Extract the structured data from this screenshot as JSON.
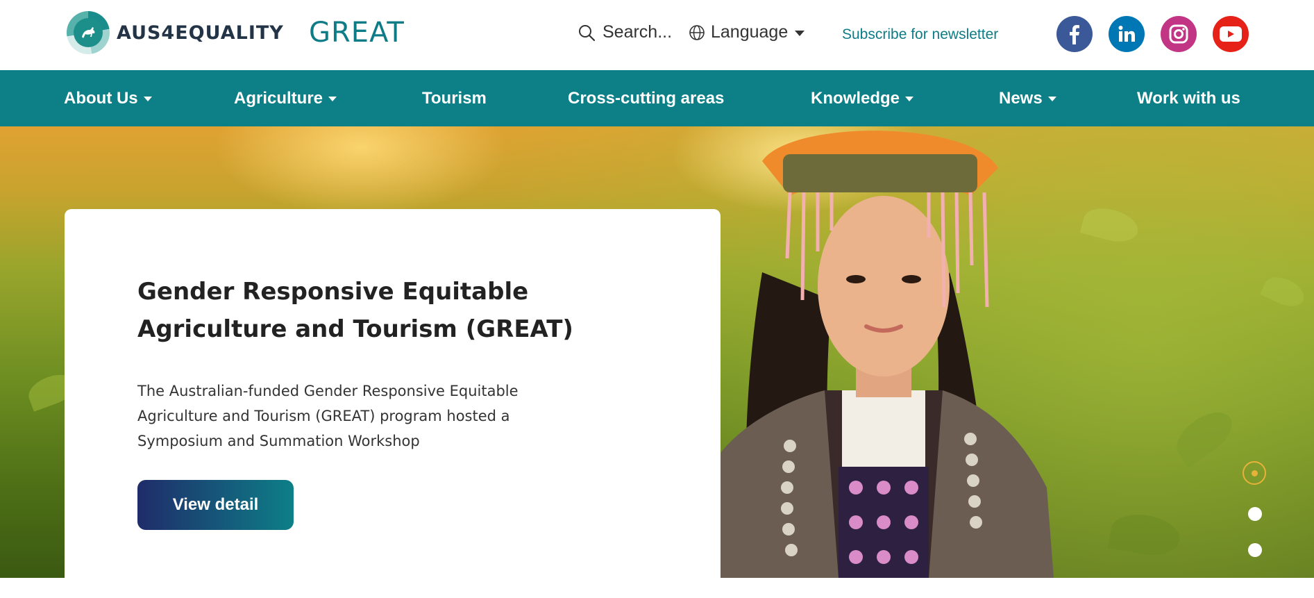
{
  "header": {
    "logo_text": "AUS4EQUALITY",
    "logo_great_text": "GREAT",
    "search_placeholder": "Search...",
    "language_label": "Language",
    "newsletter_label": "Subscribe for newsletter",
    "social": [
      {
        "name": "facebook",
        "icon": "facebook-icon",
        "color": "#3b5998"
      },
      {
        "name": "linkedin",
        "icon": "linkedin-icon",
        "color": "#0077b5"
      },
      {
        "name": "instagram",
        "icon": "instagram-icon",
        "color": "#c13584"
      },
      {
        "name": "youtube",
        "icon": "youtube-icon",
        "color": "#e62117"
      }
    ]
  },
  "nav": {
    "items": [
      {
        "label": "About Us",
        "has_dropdown": true
      },
      {
        "label": "Agriculture",
        "has_dropdown": true
      },
      {
        "label": "Tourism",
        "has_dropdown": false
      },
      {
        "label": "Cross-cutting areas",
        "has_dropdown": false
      },
      {
        "label": "Knowledge",
        "has_dropdown": true
      },
      {
        "label": "News",
        "has_dropdown": true
      },
      {
        "label": "Work with us",
        "has_dropdown": false
      }
    ],
    "background": "#0d7f87"
  },
  "hero": {
    "title": "Gender Responsive Equitable Agriculture and Tourism (GREAT)",
    "description": "The Australian-funded Gender Responsive Equitable Agriculture and Tourism (GREAT) program hosted a Symposium and Summation Workshop",
    "button_label": "View detail",
    "slides_total": 4,
    "active_slide": 1,
    "active_dot_color": "#e8b23a"
  }
}
